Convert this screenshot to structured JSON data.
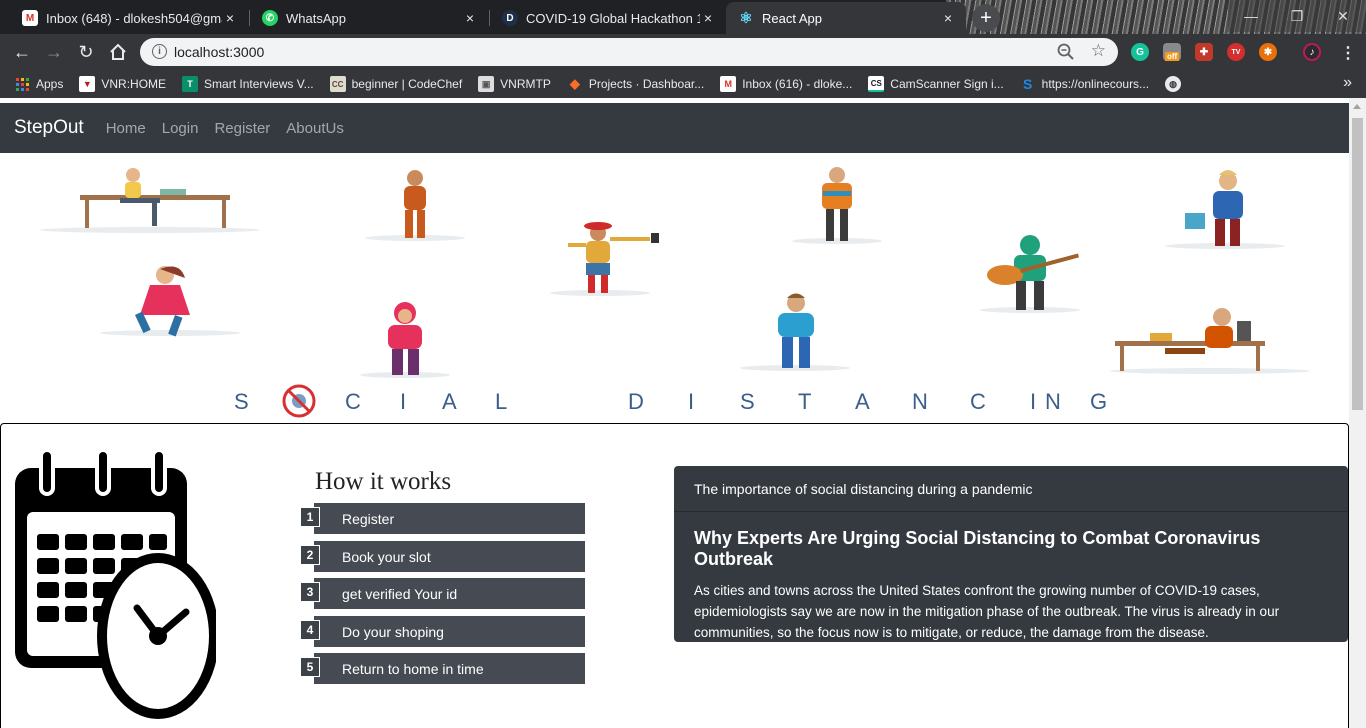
{
  "browser": {
    "tabs": [
      {
        "title": "Inbox (648) - dlokesh504@gmail",
        "icon": "gmail-icon"
      },
      {
        "title": "WhatsApp",
        "icon": "whatsapp-icon"
      },
      {
        "title": "COVID-19 Global Hackathon 1.0:",
        "icon": "devpost-icon"
      },
      {
        "title": "React App",
        "icon": "react-icon"
      }
    ],
    "new_tab": "+",
    "close_glyph": "×",
    "url": "localhost:3000",
    "bookmarks": [
      {
        "label": "Apps",
        "icon": "apps-grid-icon"
      },
      {
        "label": "VNR:HOME",
        "icon": "vnr-icon"
      },
      {
        "label": "Smart Interviews V...",
        "icon": "smart-interviews-icon"
      },
      {
        "label": "beginner | CodeChef",
        "icon": "codechef-icon"
      },
      {
        "label": "VNRMTP",
        "icon": "vnrmtp-icon"
      },
      {
        "label": "Projects · Dashboar...",
        "icon": "gitlab-icon"
      },
      {
        "label": "Inbox (616) - dloke...",
        "icon": "gmail-icon"
      },
      {
        "label": "CamScanner Sign i...",
        "icon": "camscanner-icon"
      },
      {
        "label": "https://onlinecours...",
        "icon": "s-icon"
      },
      {
        "label": "",
        "icon": "globe-icon"
      }
    ],
    "bookmarks_more": "»",
    "ext_badge": "off"
  },
  "app": {
    "brand": "StepOut",
    "nav": [
      "Home",
      "Login",
      "Register",
      "AboutUs"
    ]
  },
  "hero": {
    "words": [
      "S",
      "C",
      "I",
      "A",
      "L",
      "D",
      "I",
      "S",
      "T",
      "A",
      "N",
      "C",
      "I",
      "N",
      "G"
    ],
    "caption_color": "#3b5f8a"
  },
  "howto": {
    "title": "How it works",
    "steps": [
      {
        "num": "1",
        "label": "Register"
      },
      {
        "num": "2",
        "label": "Book your slot"
      },
      {
        "num": "3",
        "label": "get verified Your id"
      },
      {
        "num": "4",
        "label": "Do your shoping"
      },
      {
        "num": "5",
        "label": "Return to home in time"
      }
    ]
  },
  "news": {
    "header": "The importance of social distancing during a pandemic",
    "title": "Why Experts Are Urging Social Distancing to Combat Coronavirus Outbreak",
    "body": "As cities and towns across the United States confront the growing number of COVID-19 cases, epidemiologists say we are now in the mitigation phase of the outbreak. The virus is already in our communities, so the focus now is to mitigate, or reduce, the damage from the disease."
  },
  "colors": {
    "navbar": "#343a40",
    "step_bar": "#454a53",
    "chrome_dark": "#202124",
    "chrome_toolbar": "#35363a"
  }
}
